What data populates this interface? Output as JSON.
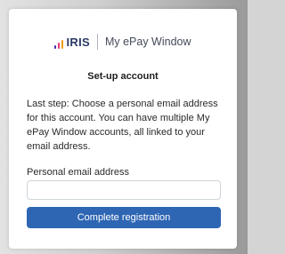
{
  "colors": {
    "logo_bar_1": "#3b2db5",
    "logo_bar_2": "#e23b6f",
    "logo_bar_3": "#f39c12",
    "primary_button": "#2f66b3"
  },
  "brand": {
    "logo_text": "IRIS",
    "product_name": "My ePay Window"
  },
  "dialog": {
    "title": "Set-up account",
    "description": "Last step: Choose a personal email address for this account. You can have multiple My ePay Window accounts, all linked to your email address.",
    "email_label": "Personal email address",
    "email_value": "",
    "email_placeholder": "",
    "submit_label": "Complete registration"
  }
}
